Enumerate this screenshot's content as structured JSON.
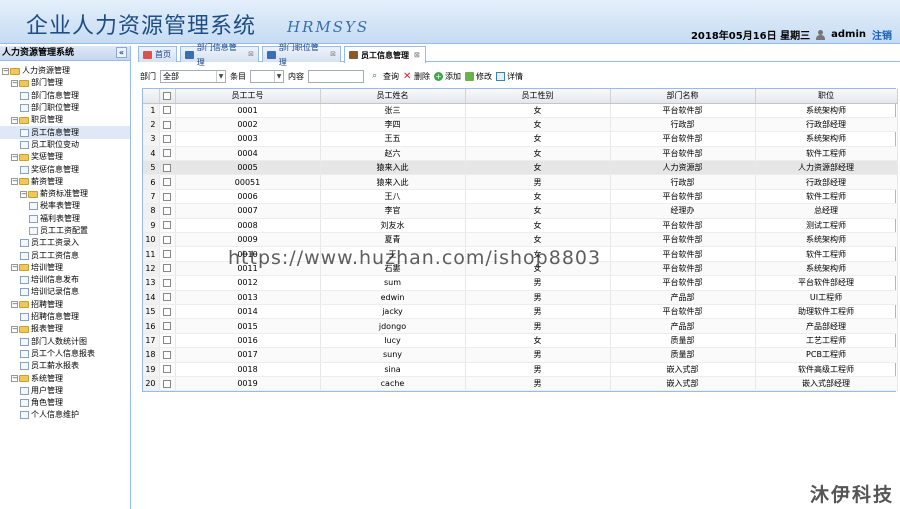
{
  "header": {
    "title": "企业人力资源管理系统",
    "subtitle": "HRMSYS",
    "date": "2018年05月16日 星期三",
    "user": "admin",
    "logout": "注销"
  },
  "sidebar": {
    "title": "人力资源管理系统",
    "collapse": "«",
    "tree": [
      {
        "label": "人力资源管理",
        "level": 0,
        "type": "folder"
      },
      {
        "label": "部门管理",
        "level": 1,
        "type": "folder"
      },
      {
        "label": "部门信息管理",
        "level": 2,
        "type": "page"
      },
      {
        "label": "部门职位管理",
        "level": 2,
        "type": "page"
      },
      {
        "label": "职员管理",
        "level": 1,
        "type": "folder"
      },
      {
        "label": "员工信息管理",
        "level": 2,
        "type": "page",
        "selected": true
      },
      {
        "label": "员工职位变动",
        "level": 2,
        "type": "page"
      },
      {
        "label": "奖惩管理",
        "level": 1,
        "type": "folder"
      },
      {
        "label": "奖惩信息管理",
        "level": 2,
        "type": "page"
      },
      {
        "label": "薪资管理",
        "level": 1,
        "type": "folder"
      },
      {
        "label": "薪资标准管理",
        "level": 2,
        "type": "folder"
      },
      {
        "label": "税率表管理",
        "level": 3,
        "type": "page"
      },
      {
        "label": "福利表管理",
        "level": 3,
        "type": "page"
      },
      {
        "label": "员工工资配置",
        "level": 3,
        "type": "page"
      },
      {
        "label": "员工工资录入",
        "level": 2,
        "type": "page"
      },
      {
        "label": "员工工资信息",
        "level": 2,
        "type": "page"
      },
      {
        "label": "培训管理",
        "level": 1,
        "type": "folder"
      },
      {
        "label": "培训信息发布",
        "level": 2,
        "type": "page"
      },
      {
        "label": "培训记录信息",
        "level": 2,
        "type": "page"
      },
      {
        "label": "招聘管理",
        "level": 1,
        "type": "folder"
      },
      {
        "label": "招聘信息管理",
        "level": 2,
        "type": "page"
      },
      {
        "label": "报表管理",
        "level": 1,
        "type": "folder"
      },
      {
        "label": "部门人数统计图",
        "level": 2,
        "type": "page"
      },
      {
        "label": "员工个人信息报表",
        "level": 2,
        "type": "page"
      },
      {
        "label": "员工薪水报表",
        "level": 2,
        "type": "page"
      },
      {
        "label": "系统管理",
        "level": 1,
        "type": "folder"
      },
      {
        "label": "用户管理",
        "level": 2,
        "type": "page"
      },
      {
        "label": "角色管理",
        "level": 2,
        "type": "page"
      },
      {
        "label": "个人信息维护",
        "level": 2,
        "type": "page"
      }
    ]
  },
  "tabs": [
    {
      "label": "首页",
      "closable": false,
      "active": false,
      "icon_color": "#d9534f"
    },
    {
      "label": "部门信息管理",
      "closable": true,
      "active": false,
      "icon_color": "#3b6db5"
    },
    {
      "label": "部门职位管理",
      "closable": true,
      "active": false,
      "icon_color": "#3b6db5"
    },
    {
      "label": "员工信息管理",
      "closable": true,
      "active": true,
      "icon_color": "#8a5a2b"
    }
  ],
  "toolbar": {
    "dept_label": "部门",
    "dept_value": "全部",
    "type_label": "条目",
    "type_value": "",
    "content_label": "内容",
    "query": "查询",
    "delete": "删除",
    "add": "添加",
    "edit": "修改",
    "detail": "详情"
  },
  "table": {
    "columns": [
      "员工工号",
      "员工姓名",
      "员工性别",
      "部门名称",
      "职位"
    ],
    "rows": [
      [
        "0001",
        "张三",
        "女",
        "平台软件部",
        "系统架构师"
      ],
      [
        "0002",
        "李四",
        "女",
        "行政部",
        "行政部经理"
      ],
      [
        "0003",
        "王五",
        "女",
        "平台软件部",
        "系统架构师"
      ],
      [
        "0004",
        "赵六",
        "女",
        "平台软件部",
        "软件工程师"
      ],
      [
        "0005",
        "猿来入此",
        "女",
        "人力资源部",
        "人力资源部经理"
      ],
      [
        "00051",
        "猿来入此",
        "男",
        "行政部",
        "行政部经理"
      ],
      [
        "0006",
        "王八",
        "女",
        "平台软件部",
        "软件工程师"
      ],
      [
        "0007",
        "李官",
        "女",
        "经理办",
        "总经理"
      ],
      [
        "0008",
        "刘友水",
        "女",
        "平台软件部",
        "测试工程师"
      ],
      [
        "0009",
        "夏青",
        "女",
        "平台软件部",
        "系统架构师"
      ],
      [
        "0010",
        "王",
        "女",
        "平台软件部",
        "软件工程师"
      ],
      [
        "0011",
        "石婁",
        "女",
        "平台软件部",
        "系统架构师"
      ],
      [
        "0012",
        "sum",
        "男",
        "平台软件部",
        "平台软件部经理"
      ],
      [
        "0013",
        "edwin",
        "男",
        "产品部",
        "UI工程师"
      ],
      [
        "0014",
        "jacky",
        "男",
        "平台软件部",
        "助理软件工程师"
      ],
      [
        "0015",
        "jdongo",
        "男",
        "产品部",
        "产品部经理"
      ],
      [
        "0016",
        "lucy",
        "女",
        "质量部",
        "工艺工程师"
      ],
      [
        "0017",
        "suny",
        "男",
        "质量部",
        "PCB工程师"
      ],
      [
        "0018",
        "sina",
        "男",
        "嵌入式部",
        "软件高级工程师"
      ],
      [
        "0019",
        "cache",
        "男",
        "嵌入式部",
        "嵌入式部经理"
      ]
    ],
    "highlight_row": 5
  },
  "watermark": "https://www.huzhan.com/ishop8803",
  "brand": "沐伊科技",
  "colors": {
    "accent": "#99bbe8",
    "title": "#1f4e86"
  }
}
